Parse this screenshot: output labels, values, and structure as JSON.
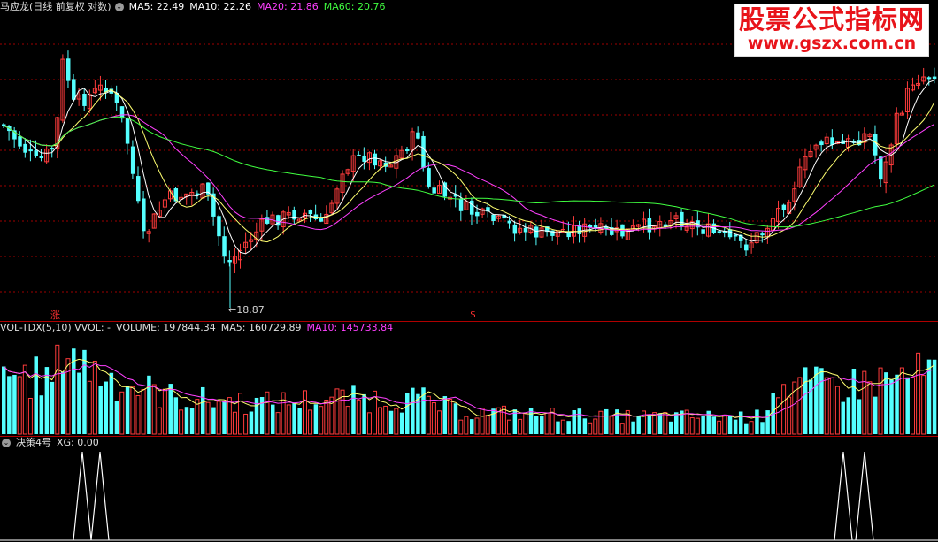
{
  "main_header": {
    "stock_title": "马应龙(日线 前复权 对数)",
    "ma5": "MA5: 22.49",
    "ma10": "MA10: 22.26",
    "ma20": "MA20: 21.86",
    "ma60": "MA60: 20.76"
  },
  "volume_header": {
    "indicator": "VOL-TDX(5,10) VVOL: -",
    "volume": "VOLUME: 197844.34",
    "ma5": "MA5: 160729.89",
    "ma10": "MA10: 145733.84"
  },
  "xg_header": {
    "title": "决策4号",
    "xg": "XG: 0.00"
  },
  "annotations": {
    "low_price": "18.87",
    "rise_tag": "涨",
    "s_tag": "$"
  },
  "watermark": {
    "line1": "股票公式指标网",
    "line2": "www.gszx.com.cn"
  },
  "colors": {
    "up": "#ff3c3c",
    "down": "#54ffff",
    "ma5": "#ffffff",
    "ma10": "#ffff70",
    "ma20": "#ff40ff",
    "ma60": "#40ff40",
    "grid": "#a00000"
  },
  "icons": {
    "panel_toggle": "circle-chevron-icon"
  }
}
